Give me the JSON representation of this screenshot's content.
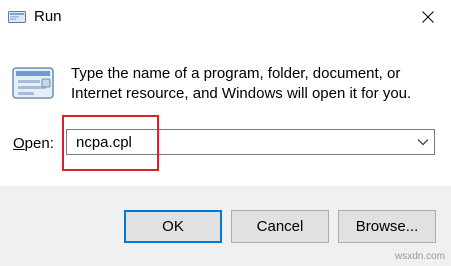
{
  "window": {
    "title": "Run",
    "title_icon": "run-icon",
    "close_icon": "close-icon"
  },
  "dialog": {
    "icon": "run-app-icon",
    "description_line1": "Type the name of a program, folder, document, or",
    "description_line2": "Internet resource, and Windows will open it for you.",
    "open_label_accel": "O",
    "open_label_rest": "pen:",
    "open_value": "ncpa.cpl",
    "dropdown_icon": "chevron-down-icon"
  },
  "buttons": {
    "ok": "OK",
    "cancel": "Cancel",
    "browse": "Browse..."
  },
  "watermark": "wsxdn.com",
  "colors": {
    "highlight": "#d9222a",
    "focus_border": "#0078d7",
    "footer_bg": "#f0f0f0"
  }
}
